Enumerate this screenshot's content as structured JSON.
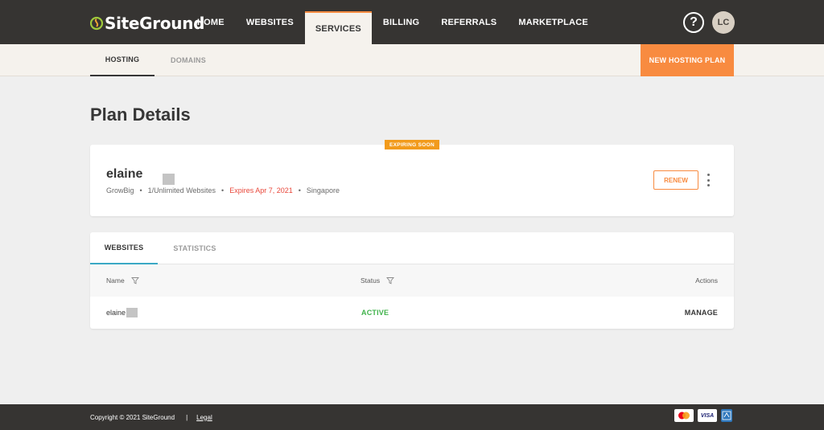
{
  "header": {
    "logo_text": "SiteGround",
    "nav": [
      {
        "label": "HOME"
      },
      {
        "label": "WEBSITES"
      },
      {
        "label": "SERVICES"
      },
      {
        "label": "BILLING"
      },
      {
        "label": "REFERRALS"
      },
      {
        "label": "MARKETPLACE"
      }
    ],
    "active_nav": "SERVICES",
    "help_label": "?",
    "avatar_initials": "LC"
  },
  "subnav": {
    "tabs": [
      {
        "label": "HOSTING"
      },
      {
        "label": "DOMAINS"
      }
    ],
    "active_tab": "HOSTING",
    "new_plan_label": "NEW HOSTING PLAN"
  },
  "page": {
    "title": "Plan Details"
  },
  "plan": {
    "badge": "EXPIRING SOON",
    "name": "elaine",
    "plan_type": "GrowBig",
    "websites": "1/Unlimited Websites",
    "expires": "Expires Apr 7, 2021",
    "location": "Singapore",
    "renew_label": "RENEW"
  },
  "sites": {
    "tabs": [
      {
        "label": "WEBSITES"
      },
      {
        "label": "STATISTICS"
      }
    ],
    "columns": {
      "name": "Name",
      "status": "Status",
      "actions": "Actions"
    },
    "rows": [
      {
        "name": "elaine",
        "status": "ACTIVE",
        "action": "MANAGE"
      }
    ]
  },
  "footer": {
    "copyright": "Copyright © 2021 SiteGround",
    "separator": "|",
    "legal": "Legal",
    "payment_icons": [
      "mastercard-icon",
      "visa-icon",
      "amex-icon"
    ],
    "visa_text": "VISA"
  },
  "colors": {
    "header_bg": "#363432",
    "accent_orange": "#f88b40",
    "badge_orange": "#f29b1c",
    "active_green": "#3fb24a",
    "expires_red": "#e8473a",
    "tab_underline_blue": "#3ba8c5"
  }
}
